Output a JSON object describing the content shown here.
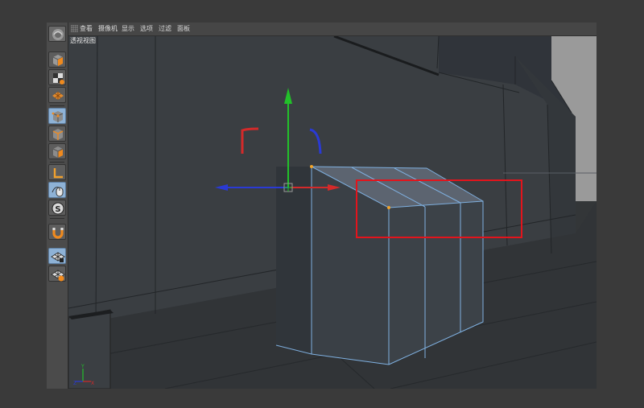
{
  "menubar": {
    "items": [
      "查看",
      "摄像机",
      "显示",
      "选项",
      "过滤",
      "面板"
    ]
  },
  "viewport": {
    "title": "透视视图"
  },
  "toolbar": {
    "tools": [
      {
        "name": "app-logo-icon",
        "active": false
      },
      {
        "name": "cube-primitive-icon",
        "active": false
      },
      {
        "name": "checker-cube-icon",
        "active": false
      },
      {
        "name": "texture-grid-icon",
        "active": false
      },
      {
        "name": "points-mode-icon",
        "active": true
      },
      {
        "name": "edges-mode-icon",
        "active": false
      },
      {
        "name": "polygons-mode-icon",
        "active": false
      },
      {
        "name": "axis-mode-icon",
        "active": false
      },
      {
        "name": "tweak-mode-icon",
        "active": true
      },
      {
        "name": "solo-icon",
        "active": false
      },
      {
        "name": "snap-magnet-icon",
        "active": false
      },
      {
        "name": "workplane-lock-icon",
        "active": true
      },
      {
        "name": "workplane-axis-icon",
        "active": false
      }
    ]
  },
  "colors": {
    "axis_x": "#d42a2a",
    "axis_y": "#22c02a",
    "axis_z": "#2a3ad4",
    "selection_edge": "#7fb0e0",
    "highlight_box": "#e3141c",
    "point_selected": "#f2a42a"
  }
}
